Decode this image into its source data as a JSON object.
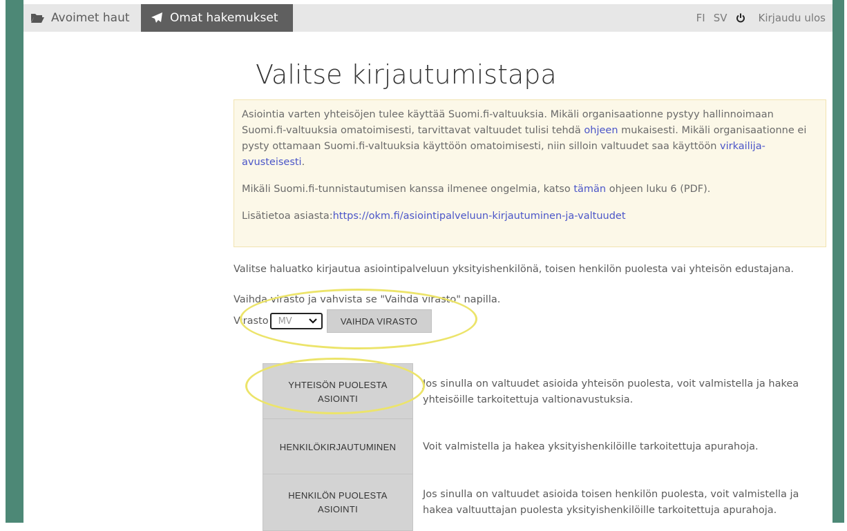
{
  "nav": {
    "tab1_label": "Avoimet haut",
    "tab2_label": "Omat hakemukset",
    "lang_fi": "FI",
    "lang_sv": "SV",
    "logout_label": "Kirjaudu ulos"
  },
  "page": {
    "title": "Valitse kirjautumistapa"
  },
  "info": {
    "p1_part1": "Asiointia varten yhteisöjen tulee käyttää Suomi.fi-valtuuksia. Mikäli organisaationne pystyy hallinnoimaan Suomi.fi-valtuuksia omatoimisesti, tarvittavat valtuudet tulisi tehdä ",
    "p1_link1": "ohjeen",
    "p1_part2": " mukaisesti. Mikäli organisaationne ei pysty ottamaan Suomi.fi-valtuuksia käyttöön omatoimisesti, niin silloin valtuudet saa käyttöön ",
    "p1_link2": "virkailija-avusteisesti",
    "p1_part3": ".",
    "p2_part1": "Mikäli Suomi.fi-tunnistautumisen kanssa ilmenee ongelmia, katso ",
    "p2_link": "tämän",
    "p2_part2": " ohjeen luku 6 (PDF).",
    "p3_part1": "Lisätietoa asiasta:",
    "p3_link": "https://okm.fi/asiointipalveluun-kirjautuminen-ja-valtuudet"
  },
  "choose_text": "Valitse haluatko kirjautua asiointipalveluun yksityishenkilönä, toisen henkilön puolesta vai yhteisön edustajana.",
  "agency": {
    "instruction": "Vaihda virasto ja vahvista se \"Vaihda virasto\" napilla.",
    "label": "Virasto",
    "selected": "MV",
    "button_label": "VAIHDA VIRASTO"
  },
  "choices": [
    {
      "button": "YHTEISÖN PUOLESTA ASIOINTI",
      "description": "Jos sinulla on valtuudet asioida yhteisön puolesta, voit valmistella ja hakea yhteisöille tarkoitettuja valtionavustuksia."
    },
    {
      "button": "HENKILÖKIRJAUTUMINEN",
      "description": "Voit valmistella ja hakea yksityishenkilöille tarkoitettuja apurahoja."
    },
    {
      "button": "HENKILÖN PUOLESTA ASIOINTI",
      "description": "Jos sinulla on valtuudet asioida toisen henkilön puolesta, voit valmistella ja hakea valtuuttajan puolesta yksityishenkilöille tarkoitettuja apurahoja."
    }
  ],
  "colors": {
    "accent_green": "#4d8876",
    "highlight_yellow": "#ece46a",
    "link_blue": "#4a55c8"
  }
}
